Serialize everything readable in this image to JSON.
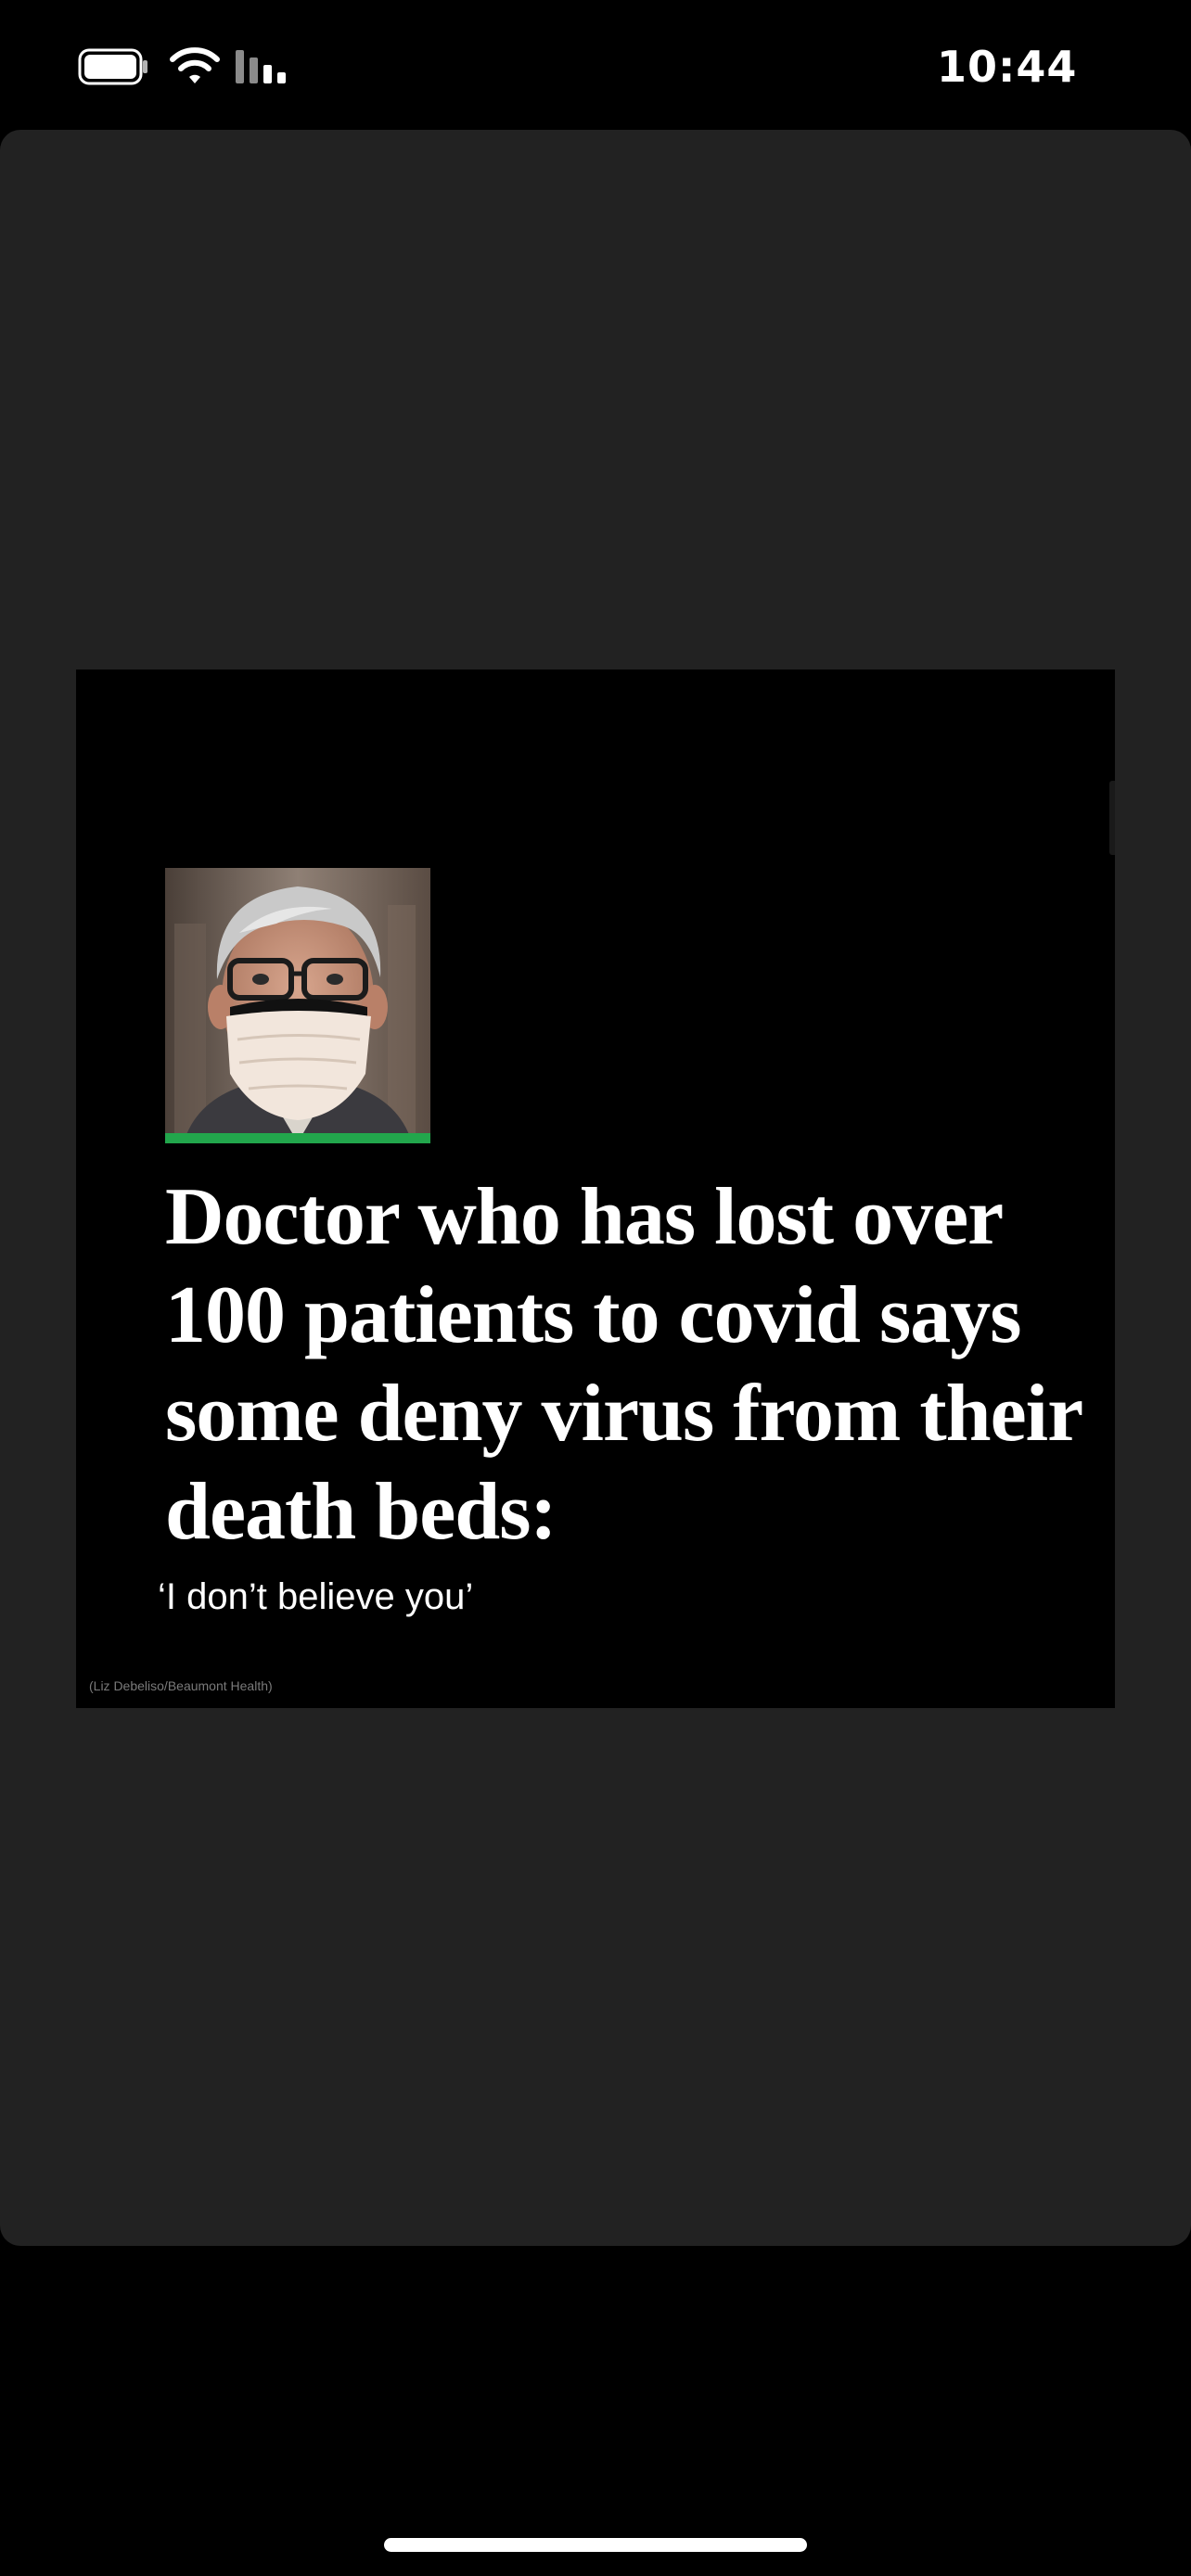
{
  "status_bar": {
    "time": "10:44",
    "icons": [
      "battery-icon",
      "wifi-icon",
      "cellular-signal-icon"
    ]
  },
  "viewer": {
    "image": {
      "portrait": "doctor-portrait",
      "headline": "Doctor who has lost over 100 patients to covid says some deny virus from their death beds:",
      "subhead": "‘I don’t believe you’",
      "credit": "(Liz Debeliso/Beaumont Health)",
      "accent_color": "#22a64c"
    }
  },
  "colors": {
    "background": "#000000",
    "panel": "#222222",
    "accent": "#22a64c"
  }
}
